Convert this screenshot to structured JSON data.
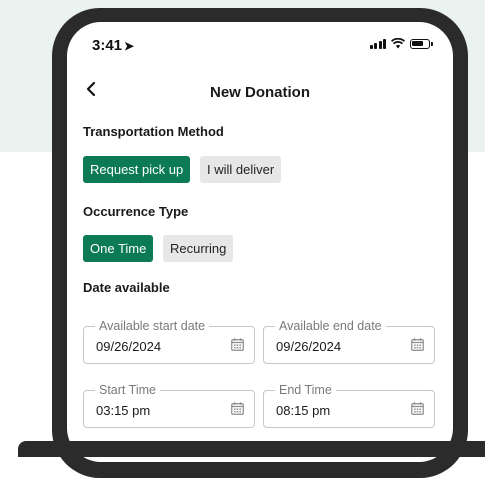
{
  "status_bar": {
    "time": "3:41"
  },
  "header": {
    "title": "New Donation",
    "back_icon": "chevron-left-icon"
  },
  "transportation": {
    "label": "Transportation Method",
    "options": [
      {
        "label": "Request pick up",
        "selected": true
      },
      {
        "label": "I will deliver",
        "selected": false
      }
    ]
  },
  "occurrence": {
    "label": "Occurrence Type",
    "options": [
      {
        "label": "One Time",
        "selected": true
      },
      {
        "label": "Recurring",
        "selected": false
      }
    ]
  },
  "date_available": {
    "label": "Date available",
    "start_date": {
      "label": "Available start date",
      "value": "09/26/2024"
    },
    "end_date": {
      "label": "Available end date",
      "value": "09/26/2024"
    },
    "start_time": {
      "label": "Start Time",
      "value": "03:15 pm"
    },
    "end_time": {
      "label": "End Time",
      "value": "08:15 pm"
    }
  },
  "colors": {
    "accent": "#0b7a55",
    "chip_inactive": "#e7e7e7",
    "background_band": "#ebf3f1",
    "phone_frame": "#2b2b2b"
  }
}
